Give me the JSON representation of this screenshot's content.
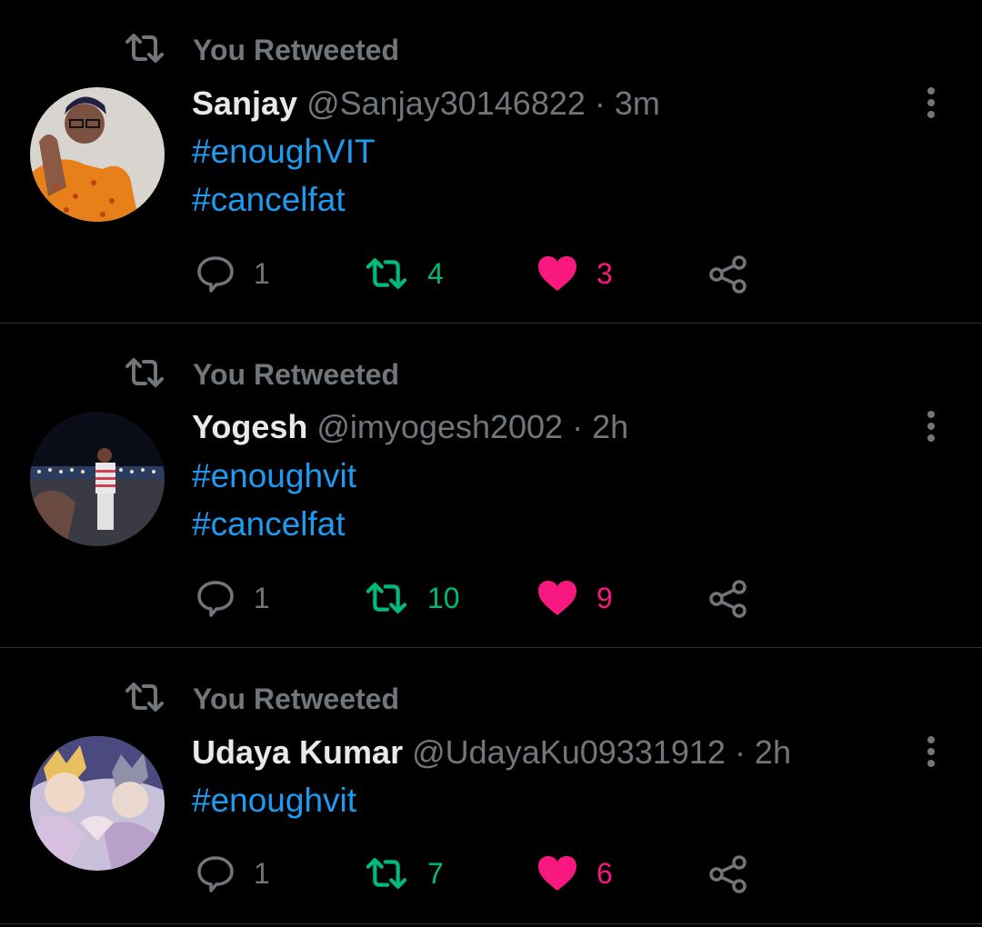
{
  "colors": {
    "background": "#000000",
    "name": "#e7e9ea",
    "meta": "#71767b",
    "hashtag": "#1d9bf0",
    "retweet": "#00ba7c",
    "like": "#f91880",
    "divider": "#2f3336"
  },
  "tweets": [
    {
      "context": "You Retweeted",
      "name": "Sanjay",
      "handle": "@Sanjay30146822",
      "time": "· 3m",
      "hashtags": [
        "#enoughVIT",
        "#cancelfat"
      ],
      "replies": "1",
      "retweets": "4",
      "likes": "3",
      "icons": {
        "retweet_context": "retweet-icon",
        "more": "more-vertical-icon",
        "reply": "reply-icon",
        "retweet": "retweet-icon",
        "like": "heart-icon",
        "share": "share-icon"
      }
    },
    {
      "context": "You Retweeted",
      "name": "Yogesh",
      "handle": "@imyogesh2002",
      "time": "· 2h",
      "hashtags": [
        "#enoughvit",
        "#cancelfat"
      ],
      "replies": "1",
      "retweets": "10",
      "likes": "9",
      "icons": {
        "retweet_context": "retweet-icon",
        "more": "more-vertical-icon",
        "reply": "reply-icon",
        "retweet": "retweet-icon",
        "like": "heart-icon",
        "share": "share-icon"
      }
    },
    {
      "context": "You Retweeted",
      "name": "Udaya Kumar",
      "handle": "@UdayaKu09331912",
      "time": "· 2h",
      "hashtags": [
        "#enoughvit"
      ],
      "replies": "1",
      "retweets": "7",
      "likes": "6",
      "icons": {
        "retweet_context": "retweet-icon",
        "more": "more-vertical-icon",
        "reply": "reply-icon",
        "retweet": "retweet-icon",
        "like": "heart-icon",
        "share": "share-icon"
      }
    }
  ]
}
